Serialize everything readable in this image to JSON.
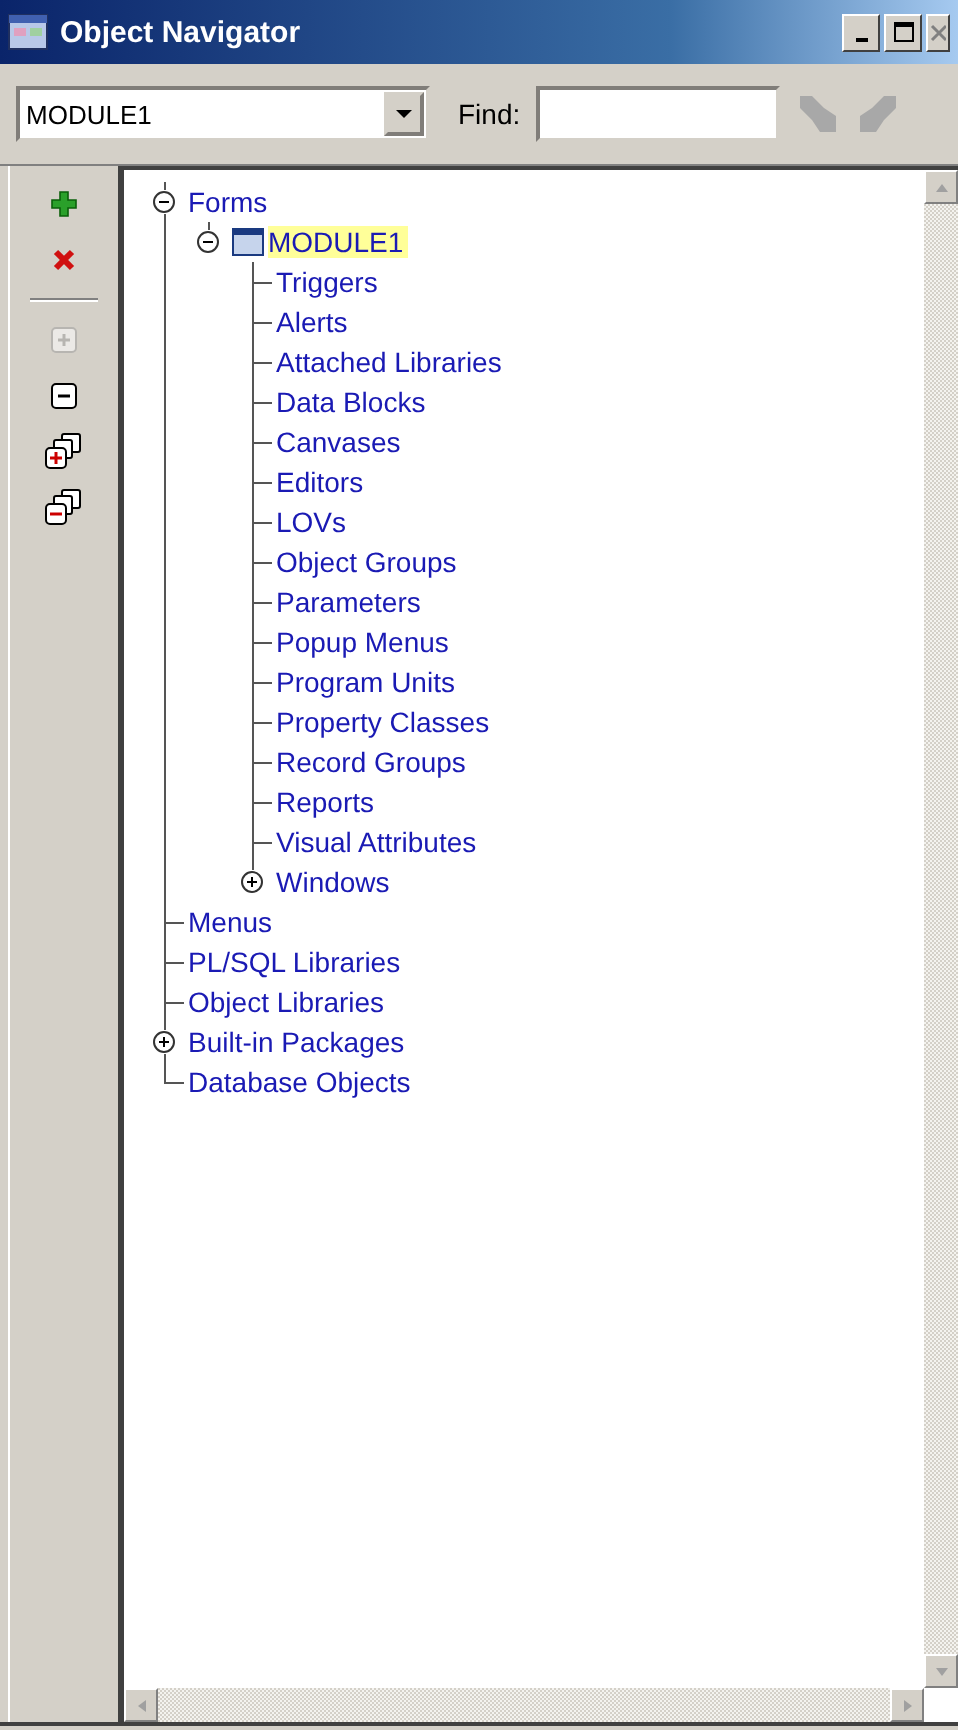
{
  "window": {
    "title": "Object Navigator"
  },
  "toolbar": {
    "module_select": {
      "value": "MODULE1"
    },
    "find": {
      "label": "Find:"
    },
    "search_buttons": [
      {
        "kind": "forward",
        "disabled": true
      },
      {
        "kind": "backward",
        "disabled": true
      }
    ]
  },
  "side_toolbar": [
    {
      "kind": "create",
      "disabled": false
    },
    {
      "kind": "delete",
      "disabled": false
    },
    {
      "kind": "separator"
    },
    {
      "kind": "expand",
      "disabled": true
    },
    {
      "kind": "collapse",
      "disabled": false
    },
    {
      "kind": "expand_all",
      "disabled": false
    },
    {
      "kind": "collapse_all",
      "disabled": false
    }
  ],
  "tree": [
    {
      "label": "Forms",
      "selected": false,
      "expanded": true,
      "children": [
        {
          "label": "MODULE1",
          "kind": "module",
          "selected": true,
          "expanded": true,
          "children": [
            {
              "label": "Triggers",
              "selected": false
            },
            {
              "label": "Alerts",
              "selected": false
            },
            {
              "label": "Attached Libraries",
              "selected": false
            },
            {
              "label": "Data Blocks",
              "selected": false
            },
            {
              "label": "Canvases",
              "selected": false
            },
            {
              "label": "Editors",
              "selected": false
            },
            {
              "label": "LOVs",
              "selected": false
            },
            {
              "label": "Object Groups",
              "selected": false
            },
            {
              "label": "Parameters",
              "selected": false
            },
            {
              "label": "Popup Menus",
              "selected": false
            },
            {
              "label": "Program Units",
              "selected": false
            },
            {
              "label": "Property Classes",
              "selected": false
            },
            {
              "label": "Record Groups",
              "selected": false
            },
            {
              "label": "Reports",
              "selected": false
            },
            {
              "label": "Visual Attributes",
              "selected": false
            },
            {
              "label": "Windows",
              "selected": false,
              "expanded": false
            }
          ]
        }
      ]
    },
    {
      "label": "Menus",
      "selected": false
    },
    {
      "label": "PL/SQL Libraries",
      "selected": false
    },
    {
      "label": "Object Libraries",
      "selected": false
    },
    {
      "label": "Built-in Packages",
      "selected": false,
      "expanded": false
    },
    {
      "label": "Database Objects",
      "selected": false
    }
  ]
}
